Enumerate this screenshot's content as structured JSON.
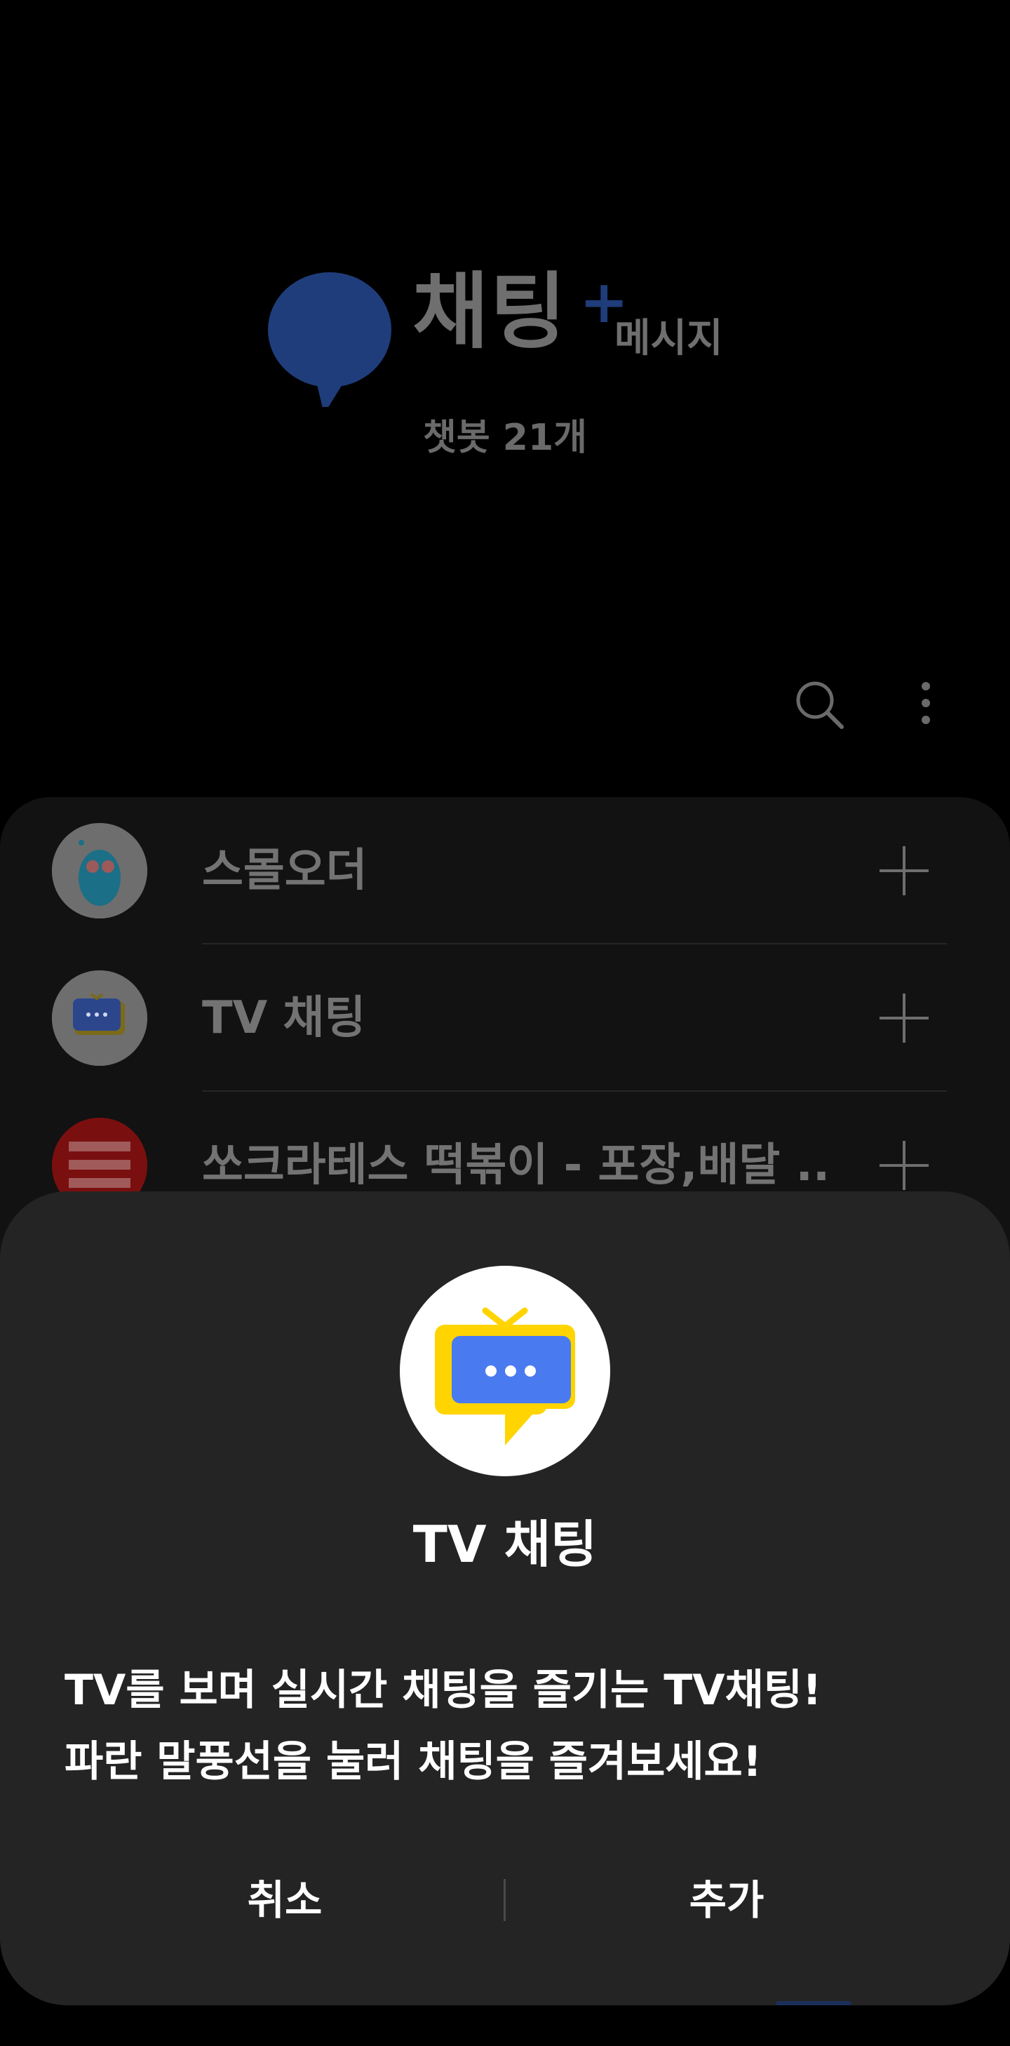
{
  "header": {
    "brand_title": "채팅",
    "brand_plus": "+",
    "brand_sub": "메시지",
    "bot_count": "챗봇 21개"
  },
  "toolbar": {
    "search_icon": "search-icon",
    "more_icon": "more-vertical-icon"
  },
  "list": {
    "items": [
      {
        "label": "스몰오더",
        "action_icon": "plus-icon"
      },
      {
        "label": "TV 채팅",
        "action_icon": "plus-icon"
      },
      {
        "label": "쏘크라테스 떡볶이 - 포장,배달 ...",
        "action_icon": "plus-icon"
      }
    ]
  },
  "sheet": {
    "title": "TV 채팅",
    "desc_line1": "TV를 보며 실시간 채팅을 즐기는 TV채팅!",
    "desc_line2": "파란 말풍선을 눌러 채팅을 즐겨보세요!",
    "cancel_label": "취소",
    "add_label": "추가"
  },
  "colors": {
    "accent_blue": "#1f3d7a",
    "tv_blue": "#4a7af0",
    "tv_yellow": "#ffd400",
    "sheet_bg": "#242424"
  }
}
